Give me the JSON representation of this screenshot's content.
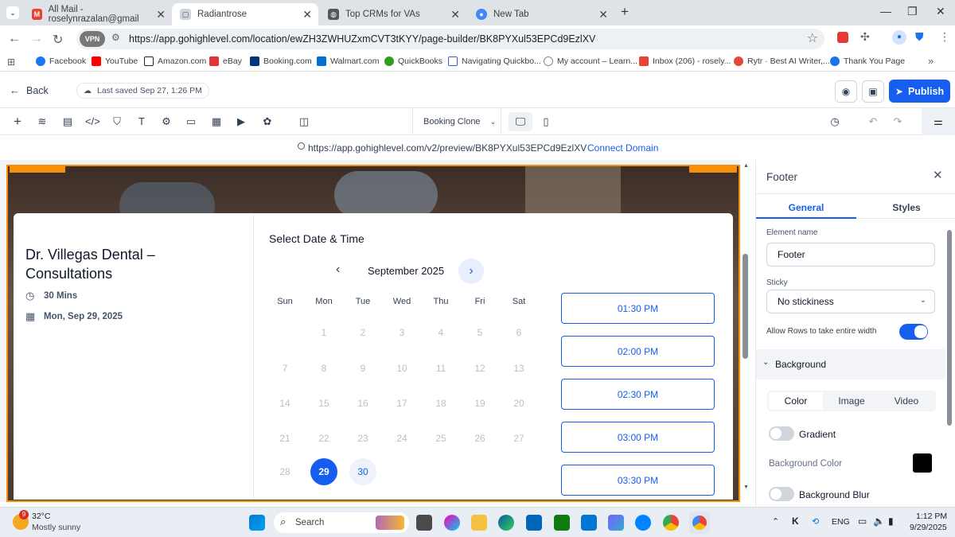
{
  "browser": {
    "tabs": [
      {
        "title": "All Mail - roselynrazalan@gmail"
      },
      {
        "title": "Radiantrose"
      },
      {
        "title": "Top CRMs for VAs"
      },
      {
        "title": "New Tab"
      }
    ],
    "new_tab": "+",
    "vpn_label": "VPN",
    "url": "https://app.gohighlevel.com/location/ewZH3ZWHUZxmCVT3tKYY/page-builder/BK8PYXul53EPCd9EzlXV",
    "bookmarks": [
      "Facebook",
      "YouTube",
      "Amazon.com",
      "eBay",
      "Booking.com",
      "Walmart.com",
      "QuickBooks",
      "Navigating Quickbo...",
      "My account – Learn...",
      "Inbox (206) - rosely...",
      "Rytr · Best AI Writer,...",
      "Thank You Page"
    ],
    "bookmark_more": "»"
  },
  "builder": {
    "back_label": "Back",
    "last_saved": "Last saved Sep 27, 1:26 PM",
    "publish_label": "Publish",
    "page_selector": "Booking Clone",
    "preview_url": "https://app.gohighlevel.com/v2/preview/BK8PYXul53EPCd9EzlXV",
    "connect_domain": "Connect Domain"
  },
  "booking": {
    "business_name": "Dr. Villegas Dental – Consultations",
    "duration": "30 Mins",
    "selected_date": "Mon, Sep 29, 2025",
    "select_title": "Select Date & Time",
    "month_label": "September 2025",
    "weekdays": [
      "Sun",
      "Mon",
      "Tue",
      "Wed",
      "Thu",
      "Fri",
      "Sat"
    ],
    "weeks": [
      [
        "",
        "1",
        "2",
        "3",
        "4",
        "5",
        "6"
      ],
      [
        "7",
        "8",
        "9",
        "10",
        "11",
        "12",
        "13"
      ],
      [
        "14",
        "15",
        "16",
        "17",
        "18",
        "19",
        "20"
      ],
      [
        "21",
        "22",
        "23",
        "24",
        "25",
        "26",
        "27"
      ],
      [
        "28",
        "29",
        "30",
        "",
        "",
        "",
        ""
      ]
    ],
    "selected_day": "29",
    "available_days": [
      "30"
    ],
    "slots": [
      "01:30 PM",
      "02:00 PM",
      "02:30 PM",
      "03:00 PM",
      "03:30 PM"
    ]
  },
  "panel": {
    "title": "Footer",
    "tab_general": "General",
    "tab_styles": "Styles",
    "element_name_label": "Element name",
    "element_name_value": "Footer",
    "sticky_label": "Sticky",
    "sticky_value": "No stickiness",
    "rows_label": "Allow Rows to take entire width",
    "rows_on": true,
    "background_section": "Background",
    "bg_tabs": [
      "Color",
      "Image",
      "Video"
    ],
    "gradient_label": "Gradient",
    "bg_color_label": "Background Color",
    "bg_color_value": "#000000",
    "blur_label": "Background Blur"
  },
  "taskbar": {
    "weather_temp": "32°C",
    "weather_desc": "Mostly sunny",
    "weather_badge": "9",
    "search_label": "Search",
    "lang": "ENG",
    "time": "1:12 PM",
    "date": "9/29/2025"
  },
  "colors": {
    "accent": "#155eef",
    "selection_outline": "#f79009"
  }
}
